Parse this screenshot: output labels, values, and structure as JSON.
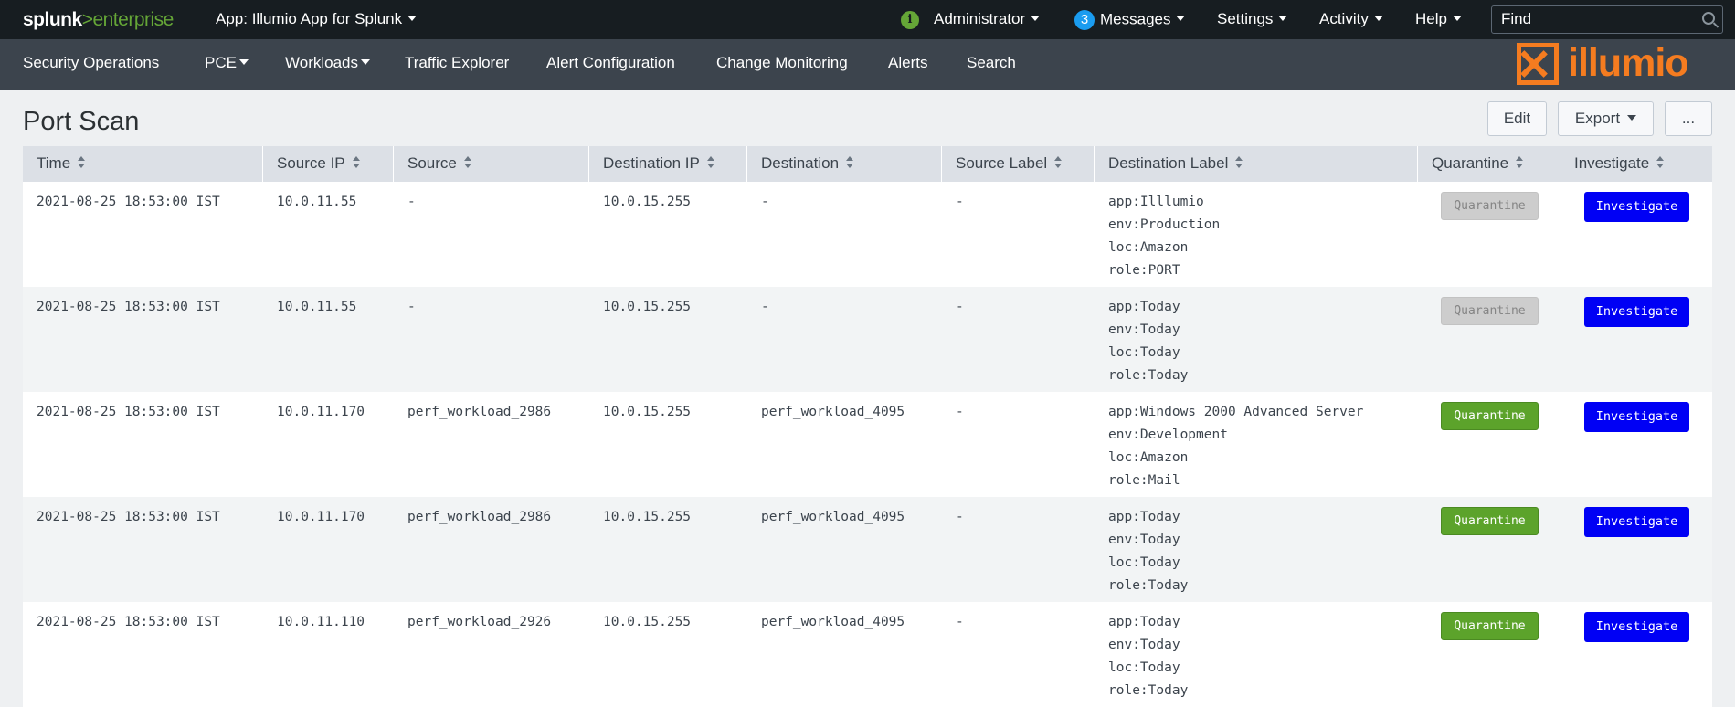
{
  "topbar": {
    "logo_splunk": "splunk",
    "logo_gt": ">",
    "logo_enterprise": "enterprise",
    "app_name": "App: Illumio App for Splunk",
    "admin": "Administrator",
    "messages_count": "3",
    "messages": "Messages",
    "settings": "Settings",
    "activity": "Activity",
    "help": "Help",
    "find_placeholder": "Find"
  },
  "appbar": {
    "items": [
      "Security Operations",
      "PCE",
      "Workloads",
      "Traffic Explorer",
      "Alert Configuration",
      "Change Monitoring",
      "Alerts",
      "Search"
    ],
    "brand": "illumio"
  },
  "panel": {
    "title": "Port Scan",
    "edit": "Edit",
    "export": "Export",
    "more": "..."
  },
  "table": {
    "columns": [
      "Time",
      "Source IP",
      "Source",
      "Destination IP",
      "Destination",
      "Source Label",
      "Destination Label",
      "Quarantine",
      "Investigate"
    ],
    "rows": [
      {
        "time": "2021-08-25 18:53:00 IST",
        "src_ip": "10.0.11.55",
        "src": "-",
        "dst_ip": "10.0.15.255",
        "dst": "-",
        "src_label": "-",
        "dst_label": [
          "app:Illlumio",
          "env:Production",
          "loc:Amazon",
          "role:PORT"
        ],
        "quarantine": "Quarantine",
        "quarantine_enabled": false,
        "investigate": "Investigate"
      },
      {
        "time": "2021-08-25 18:53:00 IST",
        "src_ip": "10.0.11.55",
        "src": "-",
        "dst_ip": "10.0.15.255",
        "dst": "-",
        "src_label": "-",
        "dst_label": [
          "app:Today",
          "env:Today",
          "loc:Today",
          "role:Today"
        ],
        "quarantine": "Quarantine",
        "quarantine_enabled": false,
        "investigate": "Investigate"
      },
      {
        "time": "2021-08-25 18:53:00 IST",
        "src_ip": "10.0.11.170",
        "src": "perf_workload_2986",
        "dst_ip": "10.0.15.255",
        "dst": "perf_workload_4095",
        "src_label": "-",
        "dst_label": [
          "app:Windows 2000 Advanced Server",
          "env:Development",
          "loc:Amazon",
          "role:Mail"
        ],
        "quarantine": "Quarantine",
        "quarantine_enabled": true,
        "investigate": "Investigate"
      },
      {
        "time": "2021-08-25 18:53:00 IST",
        "src_ip": "10.0.11.170",
        "src": "perf_workload_2986",
        "dst_ip": "10.0.15.255",
        "dst": "perf_workload_4095",
        "src_label": "-",
        "dst_label": [
          "app:Today",
          "env:Today",
          "loc:Today",
          "role:Today"
        ],
        "quarantine": "Quarantine",
        "quarantine_enabled": true,
        "investigate": "Investigate"
      },
      {
        "time": "2021-08-25 18:53:00 IST",
        "src_ip": "10.0.11.110",
        "src": "perf_workload_2926",
        "dst_ip": "10.0.15.255",
        "dst": "perf_workload_4095",
        "src_label": "-",
        "dst_label": [
          "app:Today",
          "env:Today",
          "loc:Today",
          "role:Today"
        ],
        "quarantine": "Quarantine",
        "quarantine_enabled": true,
        "investigate": "Investigate"
      }
    ]
  }
}
